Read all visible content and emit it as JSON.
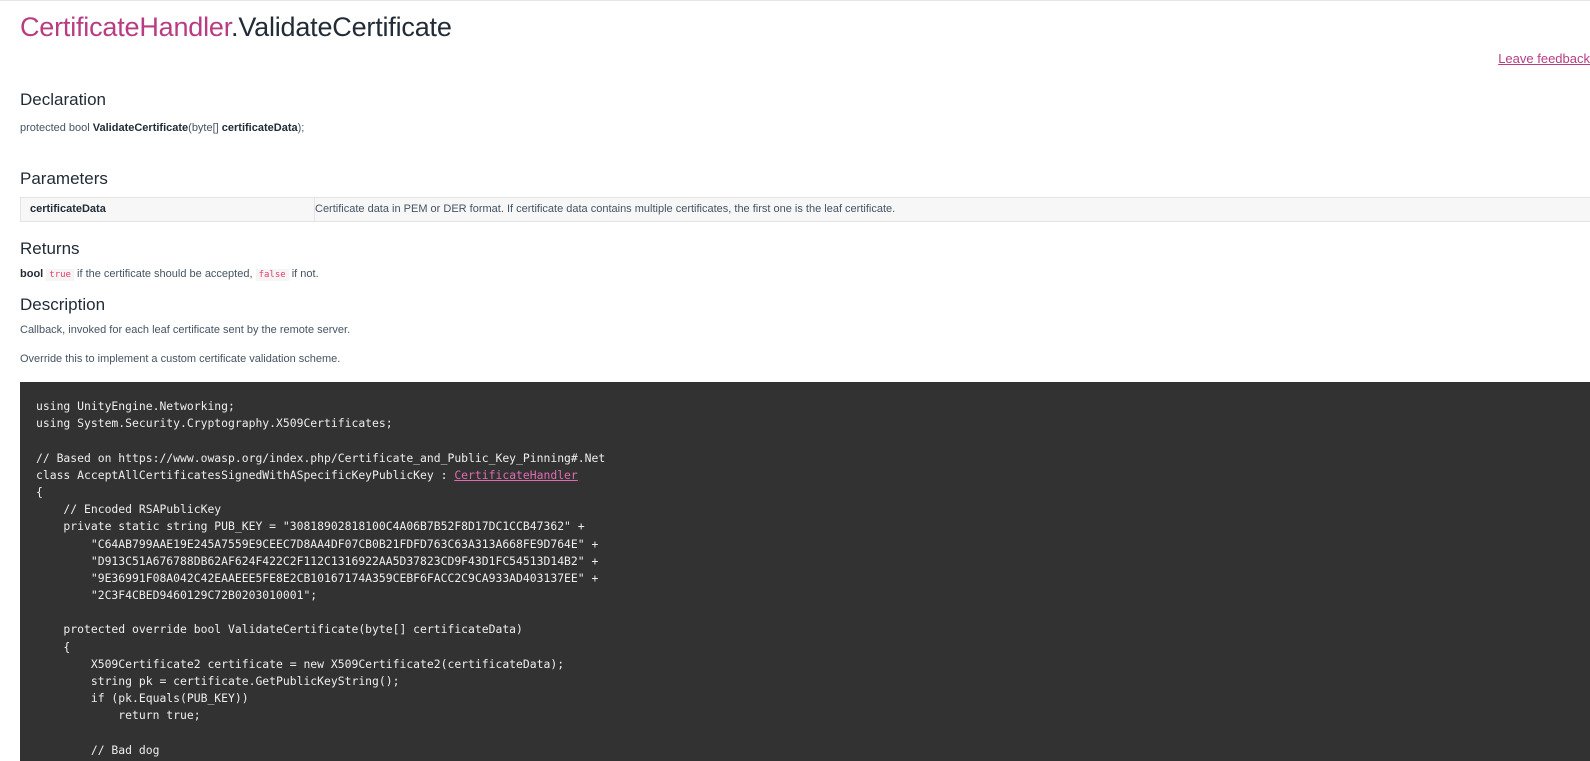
{
  "header": {
    "class_name": "CertificateHandler",
    "separator": ".",
    "method_name": "ValidateCertificate",
    "feedback_link": "Leave feedback"
  },
  "declaration": {
    "heading": "Declaration",
    "prefix": "protected bool ",
    "method": "ValidateCertificate",
    "open": "(byte[] ",
    "param": "certificateData",
    "close": ");"
  },
  "parameters": {
    "heading": "Parameters",
    "rows": [
      {
        "name": "certificateData",
        "description": "Certificate data in PEM or DER format. If certificate data contains multiple certificates, the first one is the leaf certificate."
      }
    ]
  },
  "returns": {
    "heading": "Returns",
    "type": "bool",
    "true_code": "true",
    "middle": " if the certificate should be accepted, ",
    "false_code": "false",
    "end": " if not."
  },
  "description": {
    "heading": "Description",
    "paragraphs": [
      "Callback, invoked for each leaf certificate sent by the remote server.",
      "Override this to implement a custom certificate validation scheme."
    ]
  },
  "code": {
    "lines": [
      "using UnityEngine.Networking;",
      "using System.Security.Cryptography.X509Certificates;",
      "",
      "// Based on https://www.owasp.org/index.php/Certificate_and_Public_Key_Pinning#.Net",
      "class AcceptAllCertificatesSignedWithASpecificKeyPublicKey : ",
      "{",
      "    // Encoded RSAPublicKey",
      "    private static string PUB_KEY = \"30818902818100C4A06B7B52F8D17DC1CCB47362\" +",
      "        \"C64AB799AAE19E245A7559E9CEEC7D8AA4DF07CB0B21FDFD763C63A313A668FE9D764E\" +",
      "        \"D913C51A676788DB62AF624F422C2F112C1316922AA5D37823CD9F43D1FC54513D14B2\" +",
      "        \"9E36991F08A042C42EAAEEE5FE8E2CB10167174A359CEBF6FACC2C9CA933AD403137EE\" +",
      "        \"2C3F4CBED9460129C72B0203010001\";",
      "",
      "    protected override bool ValidateCertificate(byte[] certificateData)",
      "    {",
      "        X509Certificate2 certificate = new X509Certificate2(certificateData);",
      "        string pk = certificate.GetPublicKeyString();",
      "        if (pk.Equals(PUB_KEY))",
      "            return true;",
      "",
      "        // Bad dog"
    ],
    "link_text": "CertificateHandler"
  }
}
